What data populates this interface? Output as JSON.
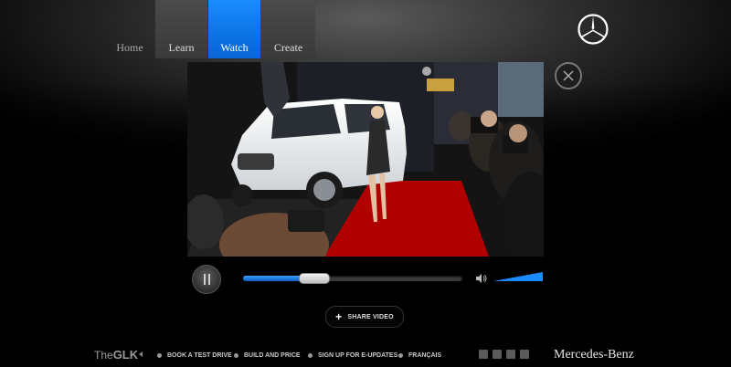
{
  "nav": {
    "items": [
      {
        "label": "Home"
      },
      {
        "label": "Learn"
      },
      {
        "label": "Watch"
      },
      {
        "label": "Create"
      }
    ],
    "active": "Watch"
  },
  "video": {
    "playback_state": "playing",
    "progress": 0.32,
    "volume": 1.0
  },
  "share": {
    "label": "SHARE VIDEO"
  },
  "footer": {
    "model_prefix": "The",
    "model_name": "GLK",
    "links": [
      {
        "label": "BOOK A TEST DRIVE",
        "icon": "steering-wheel-icon"
      },
      {
        "label": "BUILD AND PRICE",
        "icon": "build-icon"
      },
      {
        "label": "SIGN UP FOR E-UPDATES",
        "icon": "mail-icon"
      },
      {
        "label": "FRANÇAIS",
        "icon": "language-icon"
      }
    ],
    "brand": "Mercedes-Benz"
  },
  "colors": {
    "accent": "#1a8cff",
    "nav_inactive": "#444444",
    "carpet": "#b00000"
  }
}
